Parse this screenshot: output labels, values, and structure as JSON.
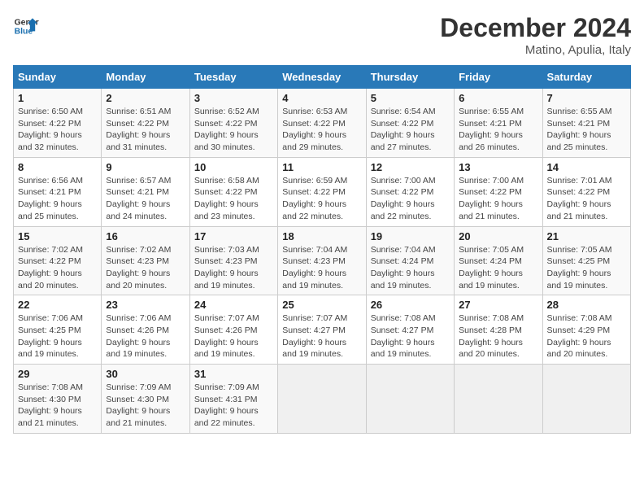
{
  "logo": {
    "line1": "General",
    "line2": "Blue"
  },
  "title": "December 2024",
  "subtitle": "Matino, Apulia, Italy",
  "days_of_week": [
    "Sunday",
    "Monday",
    "Tuesday",
    "Wednesday",
    "Thursday",
    "Friday",
    "Saturday"
  ],
  "weeks": [
    [
      {
        "day": "1",
        "info": "Sunrise: 6:50 AM\nSunset: 4:22 PM\nDaylight: 9 hours\nand 32 minutes."
      },
      {
        "day": "2",
        "info": "Sunrise: 6:51 AM\nSunset: 4:22 PM\nDaylight: 9 hours\nand 31 minutes."
      },
      {
        "day": "3",
        "info": "Sunrise: 6:52 AM\nSunset: 4:22 PM\nDaylight: 9 hours\nand 30 minutes."
      },
      {
        "day": "4",
        "info": "Sunrise: 6:53 AM\nSunset: 4:22 PM\nDaylight: 9 hours\nand 29 minutes."
      },
      {
        "day": "5",
        "info": "Sunrise: 6:54 AM\nSunset: 4:22 PM\nDaylight: 9 hours\nand 27 minutes."
      },
      {
        "day": "6",
        "info": "Sunrise: 6:55 AM\nSunset: 4:21 PM\nDaylight: 9 hours\nand 26 minutes."
      },
      {
        "day": "7",
        "info": "Sunrise: 6:55 AM\nSunset: 4:21 PM\nDaylight: 9 hours\nand 25 minutes."
      }
    ],
    [
      {
        "day": "8",
        "info": "Sunrise: 6:56 AM\nSunset: 4:21 PM\nDaylight: 9 hours\nand 25 minutes."
      },
      {
        "day": "9",
        "info": "Sunrise: 6:57 AM\nSunset: 4:21 PM\nDaylight: 9 hours\nand 24 minutes."
      },
      {
        "day": "10",
        "info": "Sunrise: 6:58 AM\nSunset: 4:22 PM\nDaylight: 9 hours\nand 23 minutes."
      },
      {
        "day": "11",
        "info": "Sunrise: 6:59 AM\nSunset: 4:22 PM\nDaylight: 9 hours\nand 22 minutes."
      },
      {
        "day": "12",
        "info": "Sunrise: 7:00 AM\nSunset: 4:22 PM\nDaylight: 9 hours\nand 22 minutes."
      },
      {
        "day": "13",
        "info": "Sunrise: 7:00 AM\nSunset: 4:22 PM\nDaylight: 9 hours\nand 21 minutes."
      },
      {
        "day": "14",
        "info": "Sunrise: 7:01 AM\nSunset: 4:22 PM\nDaylight: 9 hours\nand 21 minutes."
      }
    ],
    [
      {
        "day": "15",
        "info": "Sunrise: 7:02 AM\nSunset: 4:22 PM\nDaylight: 9 hours\nand 20 minutes."
      },
      {
        "day": "16",
        "info": "Sunrise: 7:02 AM\nSunset: 4:23 PM\nDaylight: 9 hours\nand 20 minutes."
      },
      {
        "day": "17",
        "info": "Sunrise: 7:03 AM\nSunset: 4:23 PM\nDaylight: 9 hours\nand 19 minutes."
      },
      {
        "day": "18",
        "info": "Sunrise: 7:04 AM\nSunset: 4:23 PM\nDaylight: 9 hours\nand 19 minutes."
      },
      {
        "day": "19",
        "info": "Sunrise: 7:04 AM\nSunset: 4:24 PM\nDaylight: 9 hours\nand 19 minutes."
      },
      {
        "day": "20",
        "info": "Sunrise: 7:05 AM\nSunset: 4:24 PM\nDaylight: 9 hours\nand 19 minutes."
      },
      {
        "day": "21",
        "info": "Sunrise: 7:05 AM\nSunset: 4:25 PM\nDaylight: 9 hours\nand 19 minutes."
      }
    ],
    [
      {
        "day": "22",
        "info": "Sunrise: 7:06 AM\nSunset: 4:25 PM\nDaylight: 9 hours\nand 19 minutes."
      },
      {
        "day": "23",
        "info": "Sunrise: 7:06 AM\nSunset: 4:26 PM\nDaylight: 9 hours\nand 19 minutes."
      },
      {
        "day": "24",
        "info": "Sunrise: 7:07 AM\nSunset: 4:26 PM\nDaylight: 9 hours\nand 19 minutes."
      },
      {
        "day": "25",
        "info": "Sunrise: 7:07 AM\nSunset: 4:27 PM\nDaylight: 9 hours\nand 19 minutes."
      },
      {
        "day": "26",
        "info": "Sunrise: 7:08 AM\nSunset: 4:27 PM\nDaylight: 9 hours\nand 19 minutes."
      },
      {
        "day": "27",
        "info": "Sunrise: 7:08 AM\nSunset: 4:28 PM\nDaylight: 9 hours\nand 20 minutes."
      },
      {
        "day": "28",
        "info": "Sunrise: 7:08 AM\nSunset: 4:29 PM\nDaylight: 9 hours\nand 20 minutes."
      }
    ],
    [
      {
        "day": "29",
        "info": "Sunrise: 7:08 AM\nSunset: 4:30 PM\nDaylight: 9 hours\nand 21 minutes."
      },
      {
        "day": "30",
        "info": "Sunrise: 7:09 AM\nSunset: 4:30 PM\nDaylight: 9 hours\nand 21 minutes."
      },
      {
        "day": "31",
        "info": "Sunrise: 7:09 AM\nSunset: 4:31 PM\nDaylight: 9 hours\nand 22 minutes."
      },
      {
        "day": "",
        "info": ""
      },
      {
        "day": "",
        "info": ""
      },
      {
        "day": "",
        "info": ""
      },
      {
        "day": "",
        "info": ""
      }
    ]
  ]
}
